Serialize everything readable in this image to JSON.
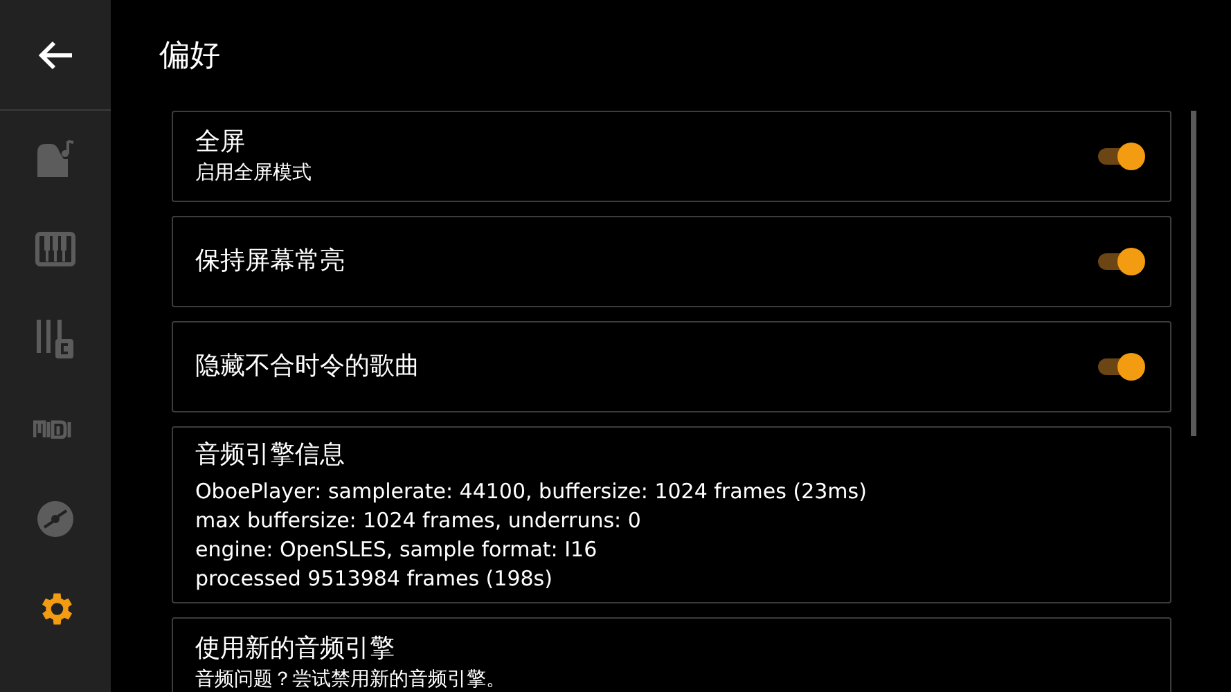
{
  "sidebar": {
    "items": [
      {
        "kind": "piano",
        "selected": false
      },
      {
        "kind": "keyboard",
        "selected": false
      },
      {
        "kind": "chords",
        "selected": false
      },
      {
        "kind": "midi",
        "selected": false
      },
      {
        "kind": "disc",
        "selected": false
      },
      {
        "kind": "settings",
        "selected": true
      }
    ]
  },
  "title": "偏好",
  "settings": [
    {
      "kind": "toggle",
      "title": "全屏",
      "subtitle": "启用全屏模式",
      "on": true
    },
    {
      "kind": "toggle",
      "title": "保持屏幕常亮",
      "on": true
    },
    {
      "kind": "toggle",
      "title": "隐藏不合时令的歌曲",
      "on": true
    },
    {
      "kind": "info",
      "title": "音频引擎信息",
      "lines": [
        "OboePlayer: samplerate: 44100, buffersize: 1024 frames (23ms)",
        "max buffersize: 1024 frames, underruns: 0",
        "engine: OpenSLES, sample format: I16",
        "processed 9513984 frames (198s)"
      ]
    },
    {
      "kind": "plain",
      "title": "使用新的音频引擎",
      "subtitle": "音频问题？尝试禁用新的音频引擎。"
    }
  ]
}
